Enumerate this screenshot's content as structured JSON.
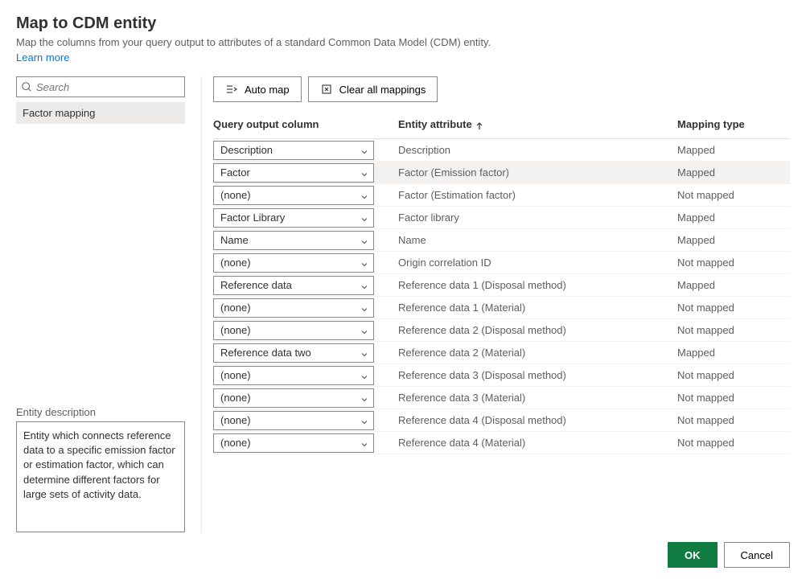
{
  "header": {
    "title": "Map to CDM entity",
    "subtitle": "Map the columns from your query output to attributes of a standard Common Data Model (CDM) entity.",
    "learn_more": "Learn more"
  },
  "search": {
    "placeholder": "Search"
  },
  "entity_list": {
    "items": [
      {
        "name": "Factor mapping"
      }
    ]
  },
  "entity_description": {
    "label": "Entity description",
    "text": "Entity which connects reference data to a specific emission factor or estimation factor, which can determine different factors for large sets of activity data."
  },
  "toolbar": {
    "auto_map": "Auto map",
    "clear_all": "Clear all mappings"
  },
  "table": {
    "headers": {
      "query": "Query output column",
      "entity": "Entity attribute",
      "mapping": "Mapping type"
    },
    "rows": [
      {
        "query": "Description",
        "entity": "Description",
        "mapping": "Mapped",
        "selected": false
      },
      {
        "query": "Factor",
        "entity": "Factor (Emission factor)",
        "mapping": "Mapped",
        "selected": true
      },
      {
        "query": "(none)",
        "entity": "Factor (Estimation factor)",
        "mapping": "Not mapped",
        "selected": false
      },
      {
        "query": "Factor Library",
        "entity": "Factor library",
        "mapping": "Mapped",
        "selected": false
      },
      {
        "query": "Name",
        "entity": "Name",
        "mapping": "Mapped",
        "selected": false
      },
      {
        "query": "(none)",
        "entity": "Origin correlation ID",
        "mapping": "Not mapped",
        "selected": false
      },
      {
        "query": "Reference data",
        "entity": "Reference data 1 (Disposal method)",
        "mapping": "Mapped",
        "selected": false
      },
      {
        "query": "(none)",
        "entity": "Reference data 1 (Material)",
        "mapping": "Not mapped",
        "selected": false
      },
      {
        "query": "(none)",
        "entity": "Reference data 2 (Disposal method)",
        "mapping": "Not mapped",
        "selected": false
      },
      {
        "query": "Reference data two",
        "entity": "Reference data 2 (Material)",
        "mapping": "Mapped",
        "selected": false
      },
      {
        "query": "(none)",
        "entity": "Reference data 3 (Disposal method)",
        "mapping": "Not mapped",
        "selected": false
      },
      {
        "query": "(none)",
        "entity": "Reference data 3 (Material)",
        "mapping": "Not mapped",
        "selected": false
      },
      {
        "query": "(none)",
        "entity": "Reference data 4 (Disposal method)",
        "mapping": "Not mapped",
        "selected": false
      },
      {
        "query": "(none)",
        "entity": "Reference data 4 (Material)",
        "mapping": "Not mapped",
        "selected": false
      }
    ]
  },
  "footer": {
    "ok": "OK",
    "cancel": "Cancel"
  }
}
